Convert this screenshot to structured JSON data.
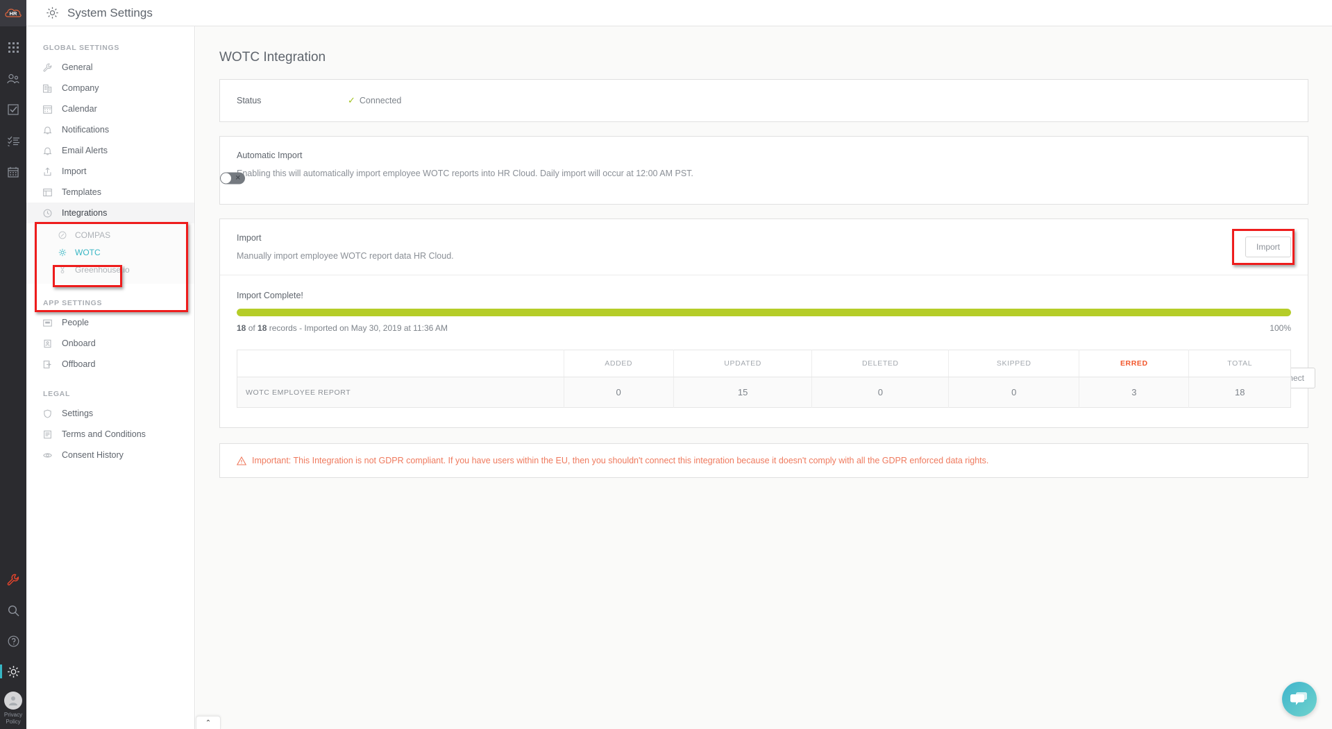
{
  "header": {
    "title": "System Settings",
    "gear_icon": "gear-icon"
  },
  "rail": {
    "logo": "HR",
    "top_icons": [
      "apps-grid-icon",
      "people-icon",
      "tasks-check-icon",
      "checklist-icon",
      "calendar-icon"
    ],
    "bottom_icons": [
      "wrench-icon",
      "search-icon",
      "help-icon",
      "gear-icon"
    ],
    "privacy_line1": "Privacy",
    "privacy_line2": "Policy"
  },
  "sidebar": {
    "groups": [
      {
        "label": "GLOBAL SETTINGS",
        "items": [
          {
            "label": "General",
            "icon": "wrench-icon"
          },
          {
            "label": "Company",
            "icon": "building-icon"
          },
          {
            "label": "Calendar",
            "icon": "calendar-icon"
          },
          {
            "label": "Notifications",
            "icon": "bell-icon"
          },
          {
            "label": "Email Alerts",
            "icon": "bell-alert-icon"
          },
          {
            "label": "Import",
            "icon": "upload-icon"
          },
          {
            "label": "Templates",
            "icon": "template-icon"
          },
          {
            "label": "Integrations",
            "icon": "clock-icon",
            "active": true
          }
        ],
        "subitems": [
          {
            "label": "COMPAS",
            "icon": "compass-icon",
            "selected": false
          },
          {
            "label": "WOTC",
            "icon": "gear-icon",
            "selected": true
          },
          {
            "label": "Greenhouse.io",
            "icon": "greenhouse-icon",
            "selected": false
          }
        ]
      },
      {
        "label": "APP SETTINGS",
        "items": [
          {
            "label": "People",
            "icon": "people-card-icon"
          },
          {
            "label": "Onboard",
            "icon": "onboard-icon"
          },
          {
            "label": "Offboard",
            "icon": "offboard-icon"
          }
        ]
      },
      {
        "label": "LEGAL",
        "items": [
          {
            "label": "Settings",
            "icon": "shield-icon"
          },
          {
            "label": "Terms and Conditions",
            "icon": "document-icon"
          },
          {
            "label": "Consent History",
            "icon": "eye-icon"
          }
        ]
      }
    ]
  },
  "main": {
    "page_title": "WOTC Integration",
    "status": {
      "label": "Status",
      "value": "Connected",
      "check_icon": "check-icon",
      "disconnect_label": "Disconnect"
    },
    "automatic_import": {
      "title": "Automatic Import",
      "description": "Enabling this will automatically import employee WOTC reports into HR Cloud. Daily import will occur at 12:00 AM PST.",
      "toggle_state": "off",
      "toggle_glyph": "✕"
    },
    "import": {
      "title": "Import",
      "description": "Manually import employee WOTC report data HR Cloud.",
      "button_label": "Import"
    },
    "progress": {
      "title": "Import Complete!",
      "percent_label": "100%",
      "percent_value": 100,
      "records_prefix": "18",
      "records_middle": " of ",
      "records_count": "18",
      "records_suffix": " records - Imported on May 30, 2019 at 11:36 AM"
    },
    "table": {
      "headers": [
        "",
        "ADDED",
        "UPDATED",
        "DELETED",
        "SKIPPED",
        "ERRED",
        "TOTAL"
      ],
      "rows": [
        {
          "label": "WOTC EMPLOYEE REPORT",
          "added": "0",
          "updated": "15",
          "deleted": "0",
          "skipped": "0",
          "erred": "3",
          "total": "18"
        }
      ]
    },
    "warning": {
      "icon": "warning-triangle-icon",
      "text": "Important: This Integration is not GDPR compliant. If you have users within the EU, then you shouldn't connect this integration because it doesn't comply with all the GDPR enforced data rights."
    },
    "scroll_tab_glyph": "⌃",
    "chat_icon": "chat-bubble-icon"
  },
  "colors": {
    "accent_teal": "#37b6c4",
    "progress_green": "#b5cd28",
    "erred_orange": "#f1562b",
    "warning_orange": "#ef7a5e",
    "highlight_red": "#ee1c1c",
    "rail_dark": "#2b2b2f"
  }
}
